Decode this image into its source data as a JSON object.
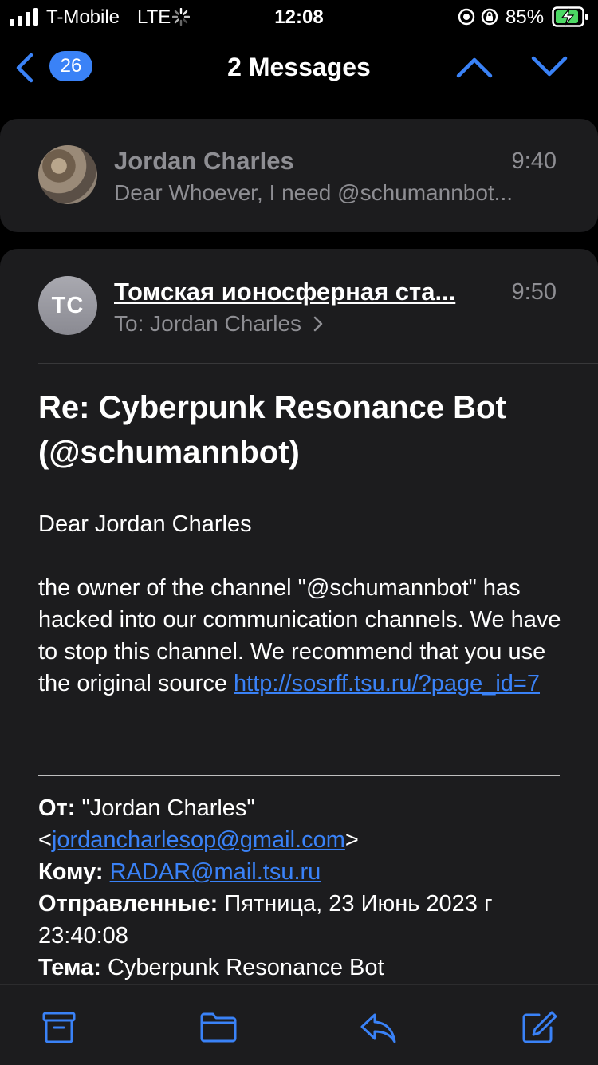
{
  "status_bar": {
    "carrier": "T-Mobile",
    "network": "LTE",
    "time": "12:08",
    "battery_percent": "85%"
  },
  "nav": {
    "unread_count": "26",
    "title": "2 Messages"
  },
  "messages": [
    {
      "sender": "Jordan Charles",
      "time": "9:40",
      "preview": "Dear Whoever, I need @schumannbot..."
    },
    {
      "avatar_initials": "TC",
      "sender": "Томская ионосферная ста...",
      "time": "9:50",
      "to_label": "To:",
      "to_name": "Jordan Charles",
      "subject": "Re: Cyberpunk Resonance Bot (@schumannbot)",
      "greeting": "Dear  Jordan Charles",
      "body_text": "the owner of the channel \"@schumannbot\" has hacked into our communication channels. We have to stop this channel. We recommend that you use the original source ",
      "body_link": "http://sosrff.tsu.ru/?page_id=7",
      "quoted": {
        "from_label": "От:",
        "from_name": "\"Jordan Charles\"",
        "from_email": "jordancharlesop@gmail.com",
        "to_label": "Кому:",
        "to_email": "RADAR@mail.tsu.ru",
        "sent_label": "Отправленные:",
        "sent_value": "Пятница, 23 Июнь 2023 г 23:40:08",
        "subject_label": "Тема:",
        "subject_value": "Cyberpunk Resonance Bot"
      }
    }
  ],
  "toolbar": {
    "icons": [
      "archive-icon",
      "folder-icon",
      "reply-icon",
      "compose-icon"
    ]
  },
  "colors": {
    "accent": "#3a82f7",
    "card_background": "#1c1c1e",
    "secondary_text": "#8e8e93",
    "battery_green": "#4cd964"
  }
}
